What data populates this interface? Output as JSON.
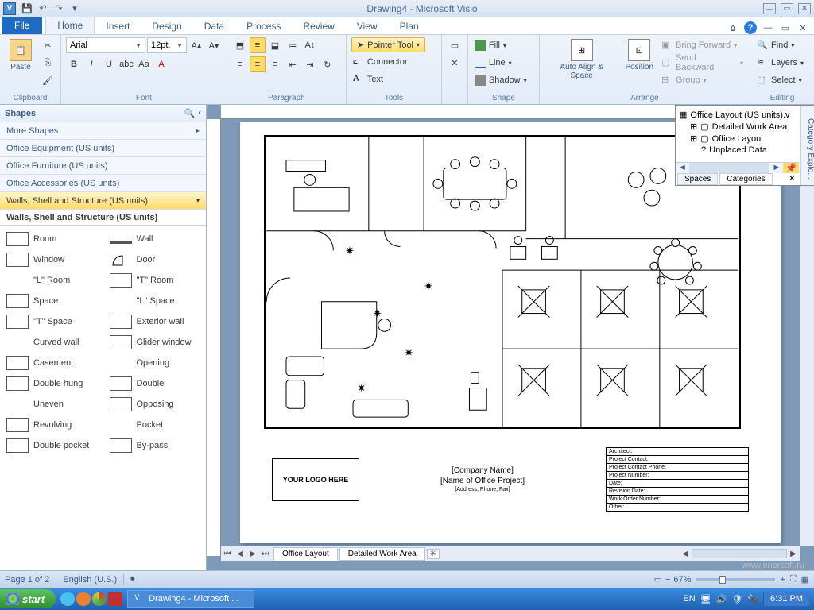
{
  "titlebar": {
    "title": "Drawing4 - Microsoft Visio",
    "app_letter": "V"
  },
  "ribbon": {
    "tabs": [
      "File",
      "Home",
      "Insert",
      "Design",
      "Data",
      "Process",
      "Review",
      "View",
      "Plan"
    ],
    "active_tab": "Home",
    "groups": {
      "clipboard": {
        "label": "Clipboard",
        "paste": "Paste"
      },
      "font": {
        "label": "Font",
        "family": "Arial",
        "size": "12pt."
      },
      "paragraph": {
        "label": "Paragraph"
      },
      "tools": {
        "label": "Tools",
        "pointer": "Pointer Tool",
        "connector": "Connector",
        "text": "Text"
      },
      "shape": {
        "label": "Shape",
        "fill": "Fill",
        "line": "Line",
        "shadow": "Shadow"
      },
      "arrange": {
        "label": "Arrange",
        "auto": "Auto Align\n& Space",
        "position": "Position",
        "bringf": "Bring Forward",
        "sendb": "Send Backward",
        "group": "Group"
      },
      "editing": {
        "label": "Editing",
        "find": "Find",
        "layers": "Layers",
        "select": "Select"
      }
    }
  },
  "shapes_panel": {
    "title": "Shapes",
    "more": "More Shapes",
    "stencils": [
      "Office Equipment (US units)",
      "Office Furniture (US units)",
      "Office Accessories (US units)",
      "Walls, Shell and Structure (US units)"
    ],
    "active_stencil": "Walls, Shell and Structure (US units)",
    "items": [
      "Room",
      "Wall",
      "Window",
      "Door",
      "\"L\" Room",
      "\"T\" Room",
      "Space",
      "\"L\" Space",
      "\"T\" Space",
      "Exterior wall",
      "Curved wall",
      "Glider window",
      "Casement",
      "Opening",
      "Double hung",
      "Double",
      "Uneven",
      "Opposing",
      "Revolving",
      "Pocket",
      "Double pocket",
      "By-pass"
    ]
  },
  "category_explorer": {
    "side_label": "Category Explo...",
    "root": "Office Layout (US units).v",
    "items": [
      "Detailed Work Area",
      "Office Layout",
      "Unplaced Data"
    ],
    "tabs": [
      "Spaces",
      "Categories"
    ],
    "active_tab": "Categories"
  },
  "page_tabs": {
    "tabs": [
      "Office Layout",
      "Detailed Work Area"
    ],
    "active": "Office Layout"
  },
  "title_block": {
    "logo": "YOUR LOGO\nHERE",
    "company": "[Company Name]",
    "project": "[Name of Office Project]",
    "addr": "[Address, Phone, Fax]",
    "fields": [
      "Architect:",
      "Project Contact:",
      "Project Contact Phone:",
      "Project Number:",
      "Date:",
      "Revision Date:",
      "Work Order Number:",
      "Other:"
    ]
  },
  "status": {
    "page": "Page 1 of 2",
    "lang": "English (U.S.)",
    "zoom": "67%"
  },
  "taskbar": {
    "start": "start",
    "app": "Drawing4 - Microsoft ...",
    "lang": "EN",
    "time": "6:31 PM"
  },
  "watermark": "www.enersoft.ru"
}
